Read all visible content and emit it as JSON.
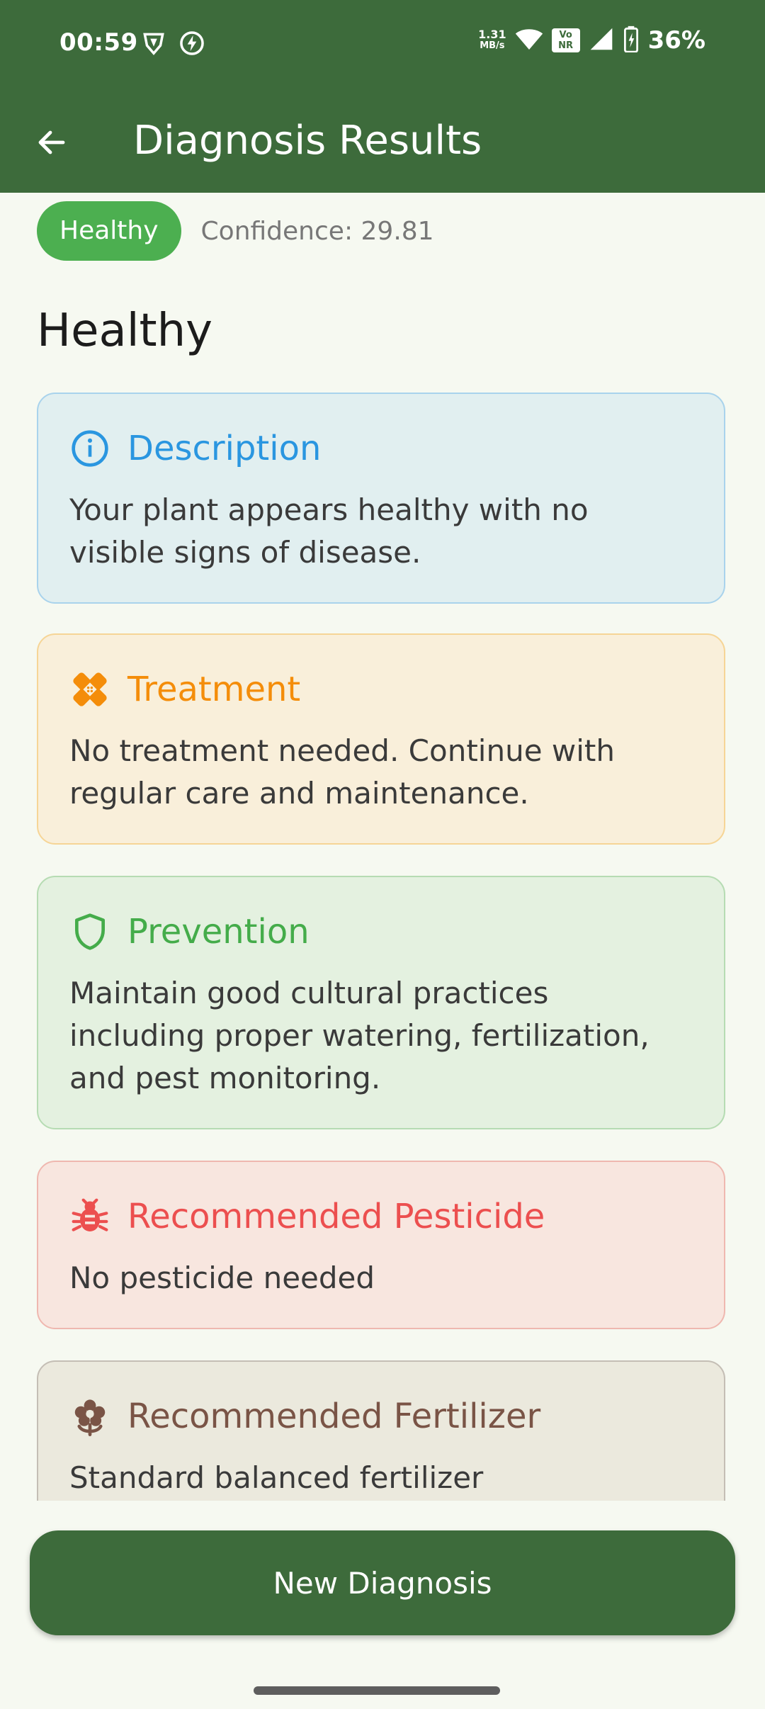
{
  "status_bar": {
    "time": "00:59",
    "net_speed_value": "1.31",
    "net_speed_unit": "MB/s",
    "volte_top": "Vo",
    "volte_bottom": "NR",
    "battery_percent": "36%"
  },
  "app_bar": {
    "title": "Diagnosis Results",
    "back_icon": "arrow-left-icon"
  },
  "result": {
    "status_label": "Healthy",
    "confidence": "Confidence: 29.81",
    "title": "Healthy"
  },
  "cards": {
    "description": {
      "title": "Description",
      "icon": "info-icon",
      "body": "Your plant appears healthy with no visible signs of disease.",
      "color": "#2a96e0"
    },
    "treatment": {
      "title": "Treatment",
      "icon": "bandage-icon",
      "body": "No treatment needed. Continue with regular care and maintenance.",
      "color": "#f48d0a"
    },
    "prevention": {
      "title": "Prevention",
      "icon": "shield-icon",
      "body": "Maintain good cultural practices including proper watering, fertilization, and pest monitoring.",
      "color": "#44ac4a"
    },
    "pesticide": {
      "title": "Recommended Pesticide",
      "icon": "bug-icon",
      "body": "No pesticide needed",
      "color": "#ec4f4f"
    },
    "fertilizer": {
      "title": "Recommended Fertilizer",
      "icon": "flower-icon",
      "body": "Standard balanced fertilizer",
      "color": "#7a5446"
    }
  },
  "actions": {
    "new_diagnosis_label": "New Diagnosis"
  },
  "colors": {
    "primary": "#3d6b3b",
    "healthy_badge": "#4caf50",
    "background": "#f6f9f1"
  }
}
